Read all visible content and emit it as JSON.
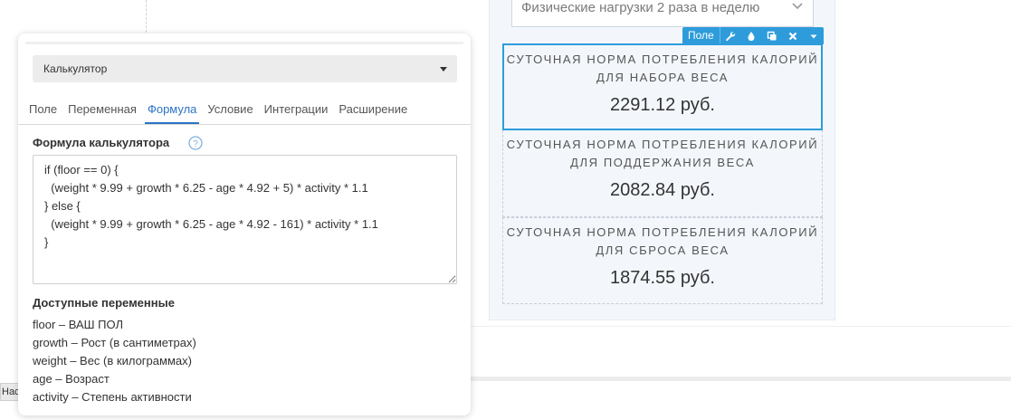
{
  "left_stub_label": "Нас",
  "preview": {
    "select_value": "Физические нагрузки 2 раза в неделю",
    "toolbar_label": "Поле",
    "boxes": [
      {
        "title_line1": "СУТОЧНАЯ НОРМА ПОТРЕБЛЕНИЯ КАЛОРИЙ",
        "title_line2": "ДЛЯ НАБОРА ВЕСА",
        "value": "2291.12 руб."
      },
      {
        "title_line1": "СУТОЧНАЯ НОРМА ПОТРЕБЛЕНИЯ КАЛОРИЙ",
        "title_line2": "ДЛЯ ПОДДЕРЖАНИЯ ВЕСА",
        "value": "2082.84 руб."
      },
      {
        "title_line1": "СУТОЧНАЯ НОРМА ПОТРЕБЛЕНИЯ КАЛОРИЙ",
        "title_line2": "ДЛЯ СБРОСА ВЕСА",
        "value": "1874.55 руб."
      }
    ]
  },
  "panel": {
    "element_select": "Калькулятор",
    "tabs": [
      "Поле",
      "Переменная",
      "Формула",
      "Условие",
      "Интеграции",
      "Расширение"
    ],
    "active_tab": "Формула",
    "formula_label": "Формула калькулятора",
    "formula": "if (floor == 0) {\n  (weight * 9.99 + growth * 6.25 - age * 4.92 + 5) * activity * 1.1\n} else {\n  (weight * 9.99 + growth * 6.25 - age * 4.92 - 161) * activity * 1.1\n}",
    "vars_title": "Доступные переменные",
    "variables": [
      "floor – ВАШ ПОЛ",
      "growth – Рост (в сантиметрах)",
      "weight – Вес (в килограммах)",
      "age – Возраст",
      "activity – Степень активности"
    ]
  },
  "colors": {
    "accent": "#2e9cdb",
    "tab_active": "#2b73c4",
    "preview_bg": "#f3f7fc"
  }
}
